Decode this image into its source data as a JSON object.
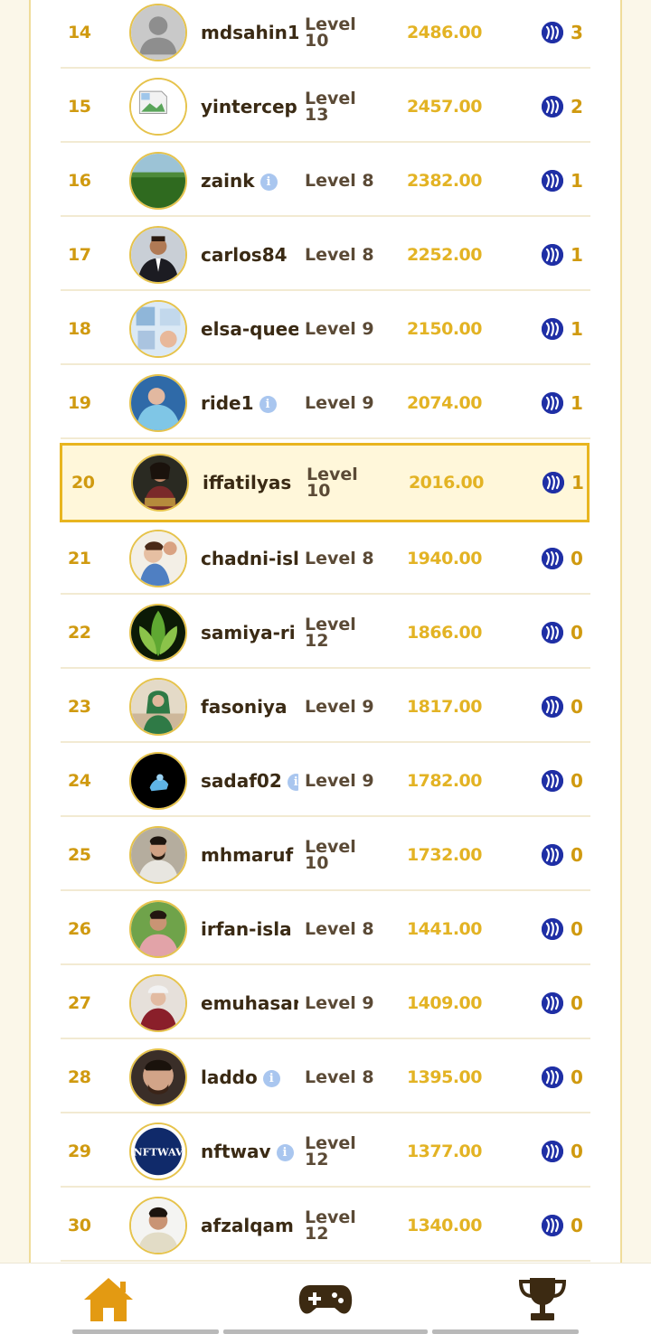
{
  "leaderboard": {
    "rows": [
      {
        "rank": "14",
        "name": "mdsahin1",
        "level_a": "Level",
        "level_b": "10",
        "score": "2486.00",
        "reward": "3",
        "info": false,
        "avatar": "placeholder-person"
      },
      {
        "rank": "15",
        "name": "yintercep",
        "level_a": "Level",
        "level_b": "13",
        "score": "2457.00",
        "reward": "2",
        "info": false,
        "avatar": "broken-image"
      },
      {
        "rank": "16",
        "name": "zaink",
        "level_a": "Level 8",
        "level_b": "",
        "score": "2382.00",
        "reward": "1",
        "info": true,
        "avatar": "green-field"
      },
      {
        "rank": "17",
        "name": "carlos84",
        "level_a": "Level 8",
        "level_b": "",
        "score": "2252.00",
        "reward": "1",
        "info": false,
        "avatar": "man-suit"
      },
      {
        "rank": "18",
        "name": "elsa-quee",
        "level_a": "Level 9",
        "level_b": "",
        "score": "2150.00",
        "reward": "1",
        "info": false,
        "avatar": "blue-collage"
      },
      {
        "rank": "19",
        "name": "ride1",
        "level_a": "Level 9",
        "level_b": "",
        "score": "2074.00",
        "reward": "1",
        "info": true,
        "avatar": "blue-person"
      },
      {
        "rank": "20",
        "name": "iffatilyas",
        "level_a": "Level",
        "level_b": "10",
        "score": "2016.00",
        "reward": "1",
        "info": false,
        "avatar": "woman-dark",
        "highlight": true
      },
      {
        "rank": "21",
        "name": "chadni-isl",
        "level_a": "Level 8",
        "level_b": "",
        "score": "1940.00",
        "reward": "0",
        "info": false,
        "avatar": "child-photo"
      },
      {
        "rank": "22",
        "name": "samiya-ri",
        "level_a": "Level",
        "level_b": "12",
        "score": "1866.00",
        "reward": "0",
        "info": false,
        "avatar": "green-leaves"
      },
      {
        "rank": "23",
        "name": "fasoniya",
        "level_a": "Level 9",
        "level_b": "",
        "score": "1817.00",
        "reward": "0",
        "info": false,
        "avatar": "woman-green"
      },
      {
        "rank": "24",
        "name": "sadaf02",
        "level_a": "Level 9",
        "level_b": "",
        "score": "1782.00",
        "reward": "0",
        "info": true,
        "avatar": "black-blue"
      },
      {
        "rank": "25",
        "name": "mhmaruf",
        "level_a": "Level",
        "level_b": "10",
        "score": "1732.00",
        "reward": "0",
        "info": false,
        "avatar": "man-beard"
      },
      {
        "rank": "26",
        "name": "irfan-isla",
        "level_a": "Level 8",
        "level_b": "",
        "score": "1441.00",
        "reward": "0",
        "info": false,
        "avatar": "man-outdoor"
      },
      {
        "rank": "27",
        "name": "emuhasar",
        "level_a": "Level 9",
        "level_b": "",
        "score": "1409.00",
        "reward": "0",
        "info": false,
        "avatar": "woman-hat"
      },
      {
        "rank": "28",
        "name": "laddo",
        "level_a": "Level 8",
        "level_b": "",
        "score": "1395.00",
        "reward": "0",
        "info": true,
        "avatar": "man-face"
      },
      {
        "rank": "29",
        "name": "nftwav",
        "level_a": "Level",
        "level_b": "12",
        "score": "1377.00",
        "reward": "0",
        "info": true,
        "avatar": "nftwav-logo",
        "avatar_text": "NFTWAV"
      },
      {
        "rank": "30",
        "name": "afzalqam",
        "level_a": "Level",
        "level_b": "12",
        "score": "1340.00",
        "reward": "0",
        "info": false,
        "avatar": "man-white"
      }
    ]
  },
  "nav": {
    "items": [
      "home",
      "games",
      "leaderboard"
    ],
    "active": "home",
    "accent": "#e39a12",
    "dark": "#3c2a12"
  },
  "colors": {
    "rank": "#d09a10",
    "score": "#e3b324",
    "highlight_border": "#e8b520",
    "highlight_bg": "#fff7da",
    "steem": "#1f2fa5"
  }
}
